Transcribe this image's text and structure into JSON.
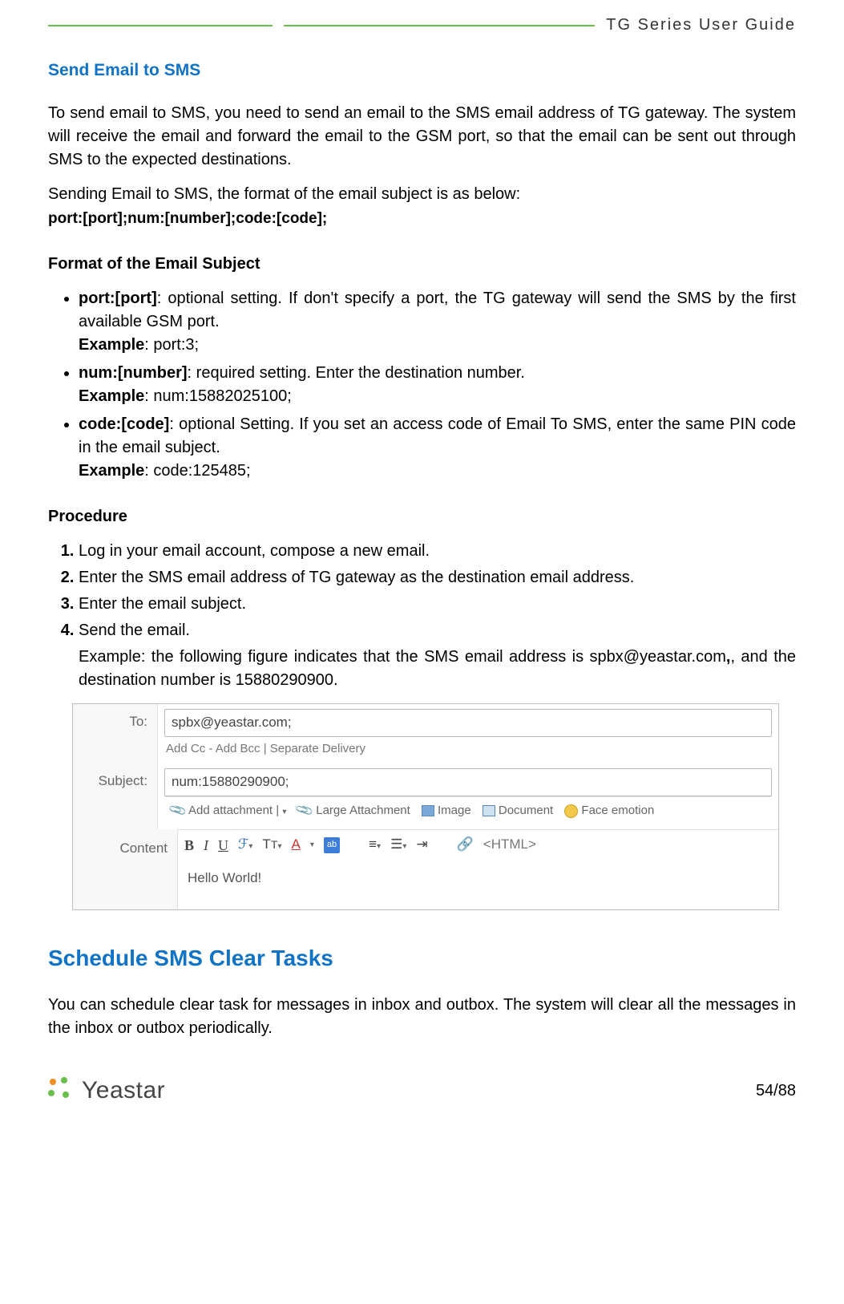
{
  "header": {
    "doc_title": "TG  Series  User  Guide"
  },
  "section1": {
    "title": "Send Email to SMS",
    "intro": "To send email to SMS, you need to send an email to the SMS email address of TG gateway. The system will receive the email and forward the email to the GSM port, so that the email can be sent out through SMS to the expected destinations.",
    "format_lead": "Sending Email to SMS, the format of the email subject is as below:",
    "format_code": "port:[port];num:[number];code:[code];",
    "subject_heading": "Format of the Email Subject",
    "bullets": [
      {
        "key": "port:[port]",
        "desc": ": optional setting. If don't specify a port, the TG gateway will send the SMS by the first available GSM port.",
        "example_label": "Example",
        "example_val": ": port:3;"
      },
      {
        "key": "num:[number]",
        "desc": ": required setting. Enter the destination number.",
        "example_label": "Example",
        "example_val": ": num:15882025100;"
      },
      {
        "key": "code:[code]",
        "desc": ": optional Setting. If you set an access code of Email To SMS, enter the same PIN code in the email subject.",
        "example_label": "Example",
        "example_val": ": code:125485;"
      }
    ],
    "procedure_heading": "Procedure",
    "steps": [
      "Log in your email account, compose a new email.",
      "Enter the SMS email address of TG gateway as the destination email address.",
      "Enter the email subject.",
      "Send the email."
    ],
    "example_note_a": "Example: the following figure indicates that the SMS email address is spbx@yeastar.com",
    "example_note_b": ", and the destination number is 15880290900."
  },
  "email_figure": {
    "to_label": "To:",
    "to_value": "spbx@yeastar.com;",
    "cc_line": "Add Cc - Add Bcc | Separate Delivery",
    "subject_label": "Subject:",
    "subject_value": "num:15880290900;",
    "attach_label": "Add attachment |",
    "large_attach": "Large Attachment",
    "image_btn": "Image",
    "document_btn": "Document",
    "face_btn": "Face emotion",
    "content_label": "Content",
    "fmt_b": "B",
    "fmt_i": "I",
    "fmt_u": "U",
    "fmt_ab": "ab",
    "fmt_html": "<HTML>",
    "body_text": "Hello World!"
  },
  "section2": {
    "title": "Schedule SMS Clear Tasks",
    "para": "You can schedule clear task for messages in inbox and outbox. The system will clear all the messages in the inbox or outbox periodically."
  },
  "footer": {
    "brand": "Yeastar",
    "page": "54/88"
  }
}
